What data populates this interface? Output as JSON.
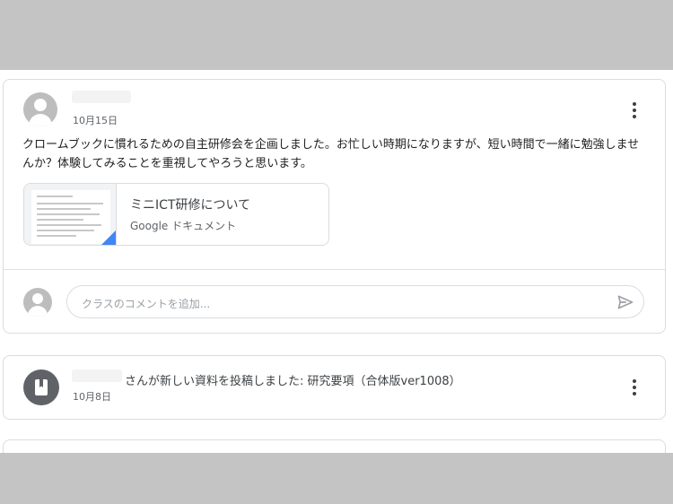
{
  "post": {
    "date": "10月15日",
    "text": "クロームブックに慣れるための自主研修会を企画しました。お忙しい時期になりますが、短い時間で一緒に勉強しませんか？体験してみることを重視してやろうと思います。",
    "attachment": {
      "title": "ミニICT研修について",
      "type": "Google ドキュメント"
    },
    "comment_placeholder": "クラスのコメントを追加..."
  },
  "notice": {
    "text": "さんが新しい資料を投稿しました: 研究要項（合体版ver1008）",
    "date": "10月8日"
  },
  "colors": {
    "page_band": "#c4c4c4",
    "card_border": "#dadce0",
    "doc_accent": "#4285f4",
    "material_icon_bg": "#5f6368"
  },
  "icons": {
    "post_avatar": "person-avatar-icon",
    "post_menu": "more-vert-icon",
    "attachment": "google-docs-thumbnail",
    "comment_avatar": "person-avatar-icon",
    "send": "send-icon",
    "notice_icon": "book-material-icon",
    "notice_menu": "more-vert-icon"
  }
}
